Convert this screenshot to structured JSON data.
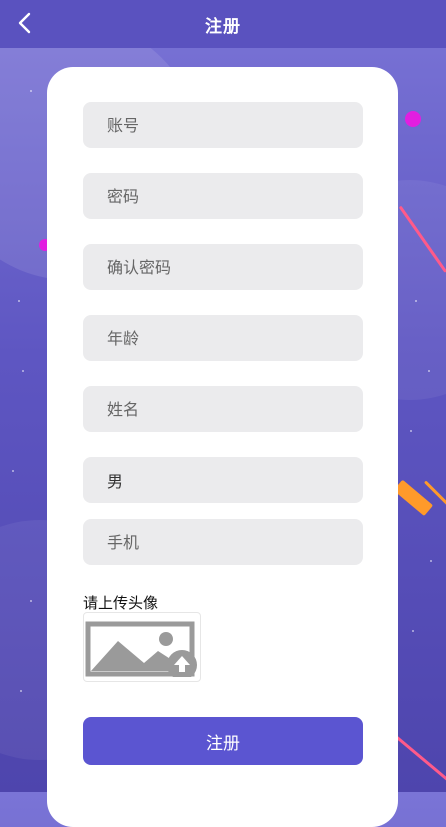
{
  "header": {
    "title": "注册",
    "back_icon": "chevron-left-icon"
  },
  "form": {
    "account_placeholder": "账号",
    "password_placeholder": "密码",
    "confirm_password_placeholder": "确认密码",
    "age_placeholder": "年龄",
    "name_placeholder": "姓名",
    "gender_value": "男",
    "phone_placeholder": "手机",
    "upload_label": "请上传头像",
    "upload_icon": "image-upload-icon",
    "submit_label": "注册"
  },
  "colors": {
    "accent": "#5b55d1",
    "header": "#5a52bf",
    "field_bg": "#ebebed"
  }
}
